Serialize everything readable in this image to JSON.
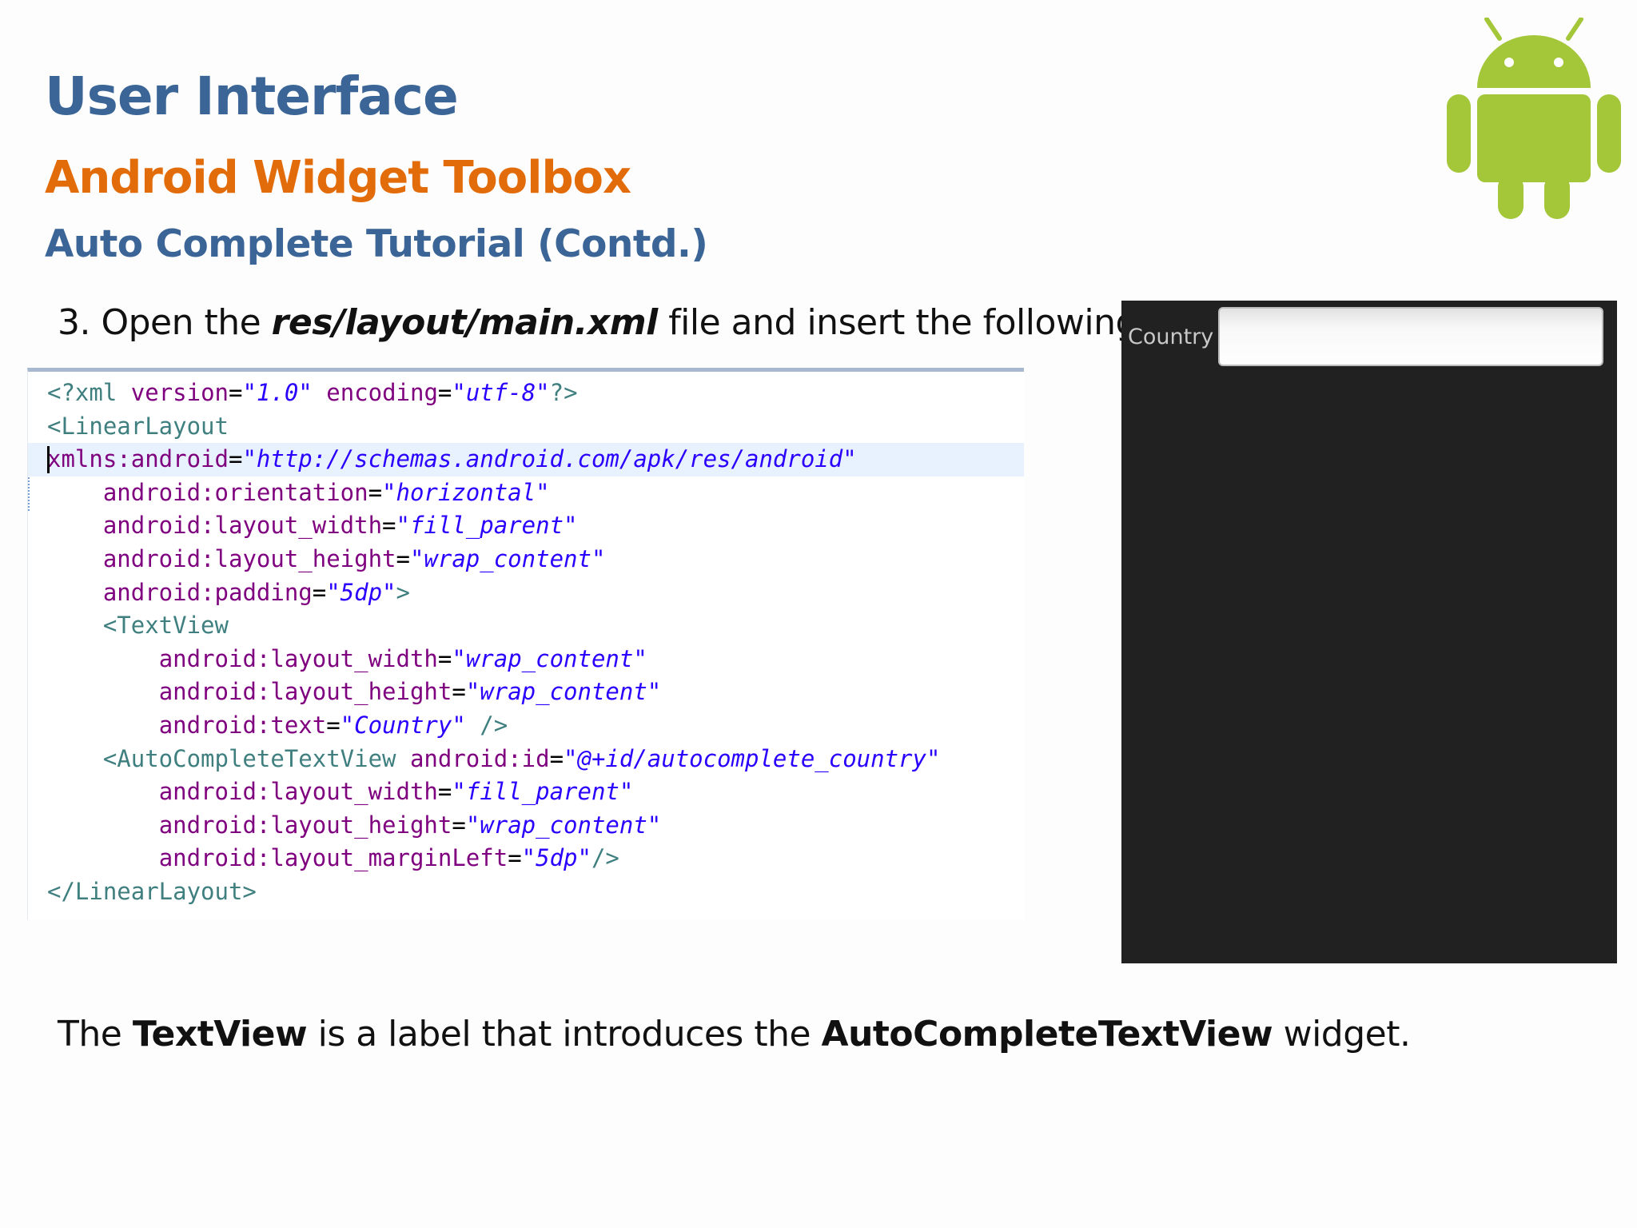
{
  "slide": {
    "title": "User Interface",
    "subtitle": "Android Widget Toolbox",
    "subtitle2": "Auto Complete Tutorial (Contd.)",
    "logo_icon": "android-robot-icon",
    "colors": {
      "title": "#3b6596",
      "subtitle": "#e36c0a",
      "logo": "#a4c639"
    }
  },
  "instruction": {
    "prefix": "3. Open the ",
    "path": "res/layout/main.xml",
    "suffix": " file and insert the following:"
  },
  "code": [
    [
      {
        "t": "tag",
        "v": "<?xml "
      },
      {
        "t": "attr",
        "v": "version"
      },
      {
        "t": "eq",
        "v": "="
      },
      {
        "t": "val",
        "v": "\"1.0\""
      },
      {
        "t": "tag",
        "v": " "
      },
      {
        "t": "attr",
        "v": "encoding"
      },
      {
        "t": "eq",
        "v": "="
      },
      {
        "t": "val",
        "v": "\"utf-8\""
      },
      {
        "t": "tag",
        "v": "?>"
      }
    ],
    [
      {
        "t": "tag",
        "v": "<LinearLayout"
      }
    ],
    [
      {
        "t": "attr",
        "v": "xmlns:android"
      },
      {
        "t": "eq",
        "v": "="
      },
      {
        "t": "val",
        "v": "\"http://schemas.android.com/apk/res/android\""
      }
    ],
    [
      {
        "t": "tag",
        "v": "    "
      },
      {
        "t": "attr",
        "v": "android:orientation"
      },
      {
        "t": "eq",
        "v": "="
      },
      {
        "t": "val",
        "v": "\"horizontal\""
      }
    ],
    [
      {
        "t": "tag",
        "v": "    "
      },
      {
        "t": "attr",
        "v": "android:layout_width"
      },
      {
        "t": "eq",
        "v": "="
      },
      {
        "t": "val",
        "v": "\"fill_parent\""
      }
    ],
    [
      {
        "t": "tag",
        "v": "    "
      },
      {
        "t": "attr",
        "v": "android:layout_height"
      },
      {
        "t": "eq",
        "v": "="
      },
      {
        "t": "val",
        "v": "\"wrap_content\""
      }
    ],
    [
      {
        "t": "tag",
        "v": "    "
      },
      {
        "t": "attr",
        "v": "android:padding"
      },
      {
        "t": "eq",
        "v": "="
      },
      {
        "t": "val",
        "v": "\"5dp\""
      },
      {
        "t": "tag",
        "v": ">"
      }
    ],
    [
      {
        "t": "tag",
        "v": "    <TextView"
      }
    ],
    [
      {
        "t": "tag",
        "v": "        "
      },
      {
        "t": "attr",
        "v": "android:layout_width"
      },
      {
        "t": "eq",
        "v": "="
      },
      {
        "t": "val",
        "v": "\"wrap_content\""
      }
    ],
    [
      {
        "t": "tag",
        "v": "        "
      },
      {
        "t": "attr",
        "v": "android:layout_height"
      },
      {
        "t": "eq",
        "v": "="
      },
      {
        "t": "val",
        "v": "\"wrap_content\""
      }
    ],
    [
      {
        "t": "tag",
        "v": "        "
      },
      {
        "t": "attr",
        "v": "android:text"
      },
      {
        "t": "eq",
        "v": "="
      },
      {
        "t": "val",
        "v": "\"Country\""
      },
      {
        "t": "tag",
        "v": " />"
      }
    ],
    [
      {
        "t": "tag",
        "v": "    <AutoCompleteTextView "
      },
      {
        "t": "attr",
        "v": "android:id"
      },
      {
        "t": "eq",
        "v": "="
      },
      {
        "t": "val",
        "v": "\"@+id/autocomplete_country\""
      }
    ],
    [
      {
        "t": "tag",
        "v": "        "
      },
      {
        "t": "attr",
        "v": "android:layout_width"
      },
      {
        "t": "eq",
        "v": "="
      },
      {
        "t": "val",
        "v": "\"fill_parent\""
      }
    ],
    [
      {
        "t": "tag",
        "v": "        "
      },
      {
        "t": "attr",
        "v": "android:layout_height"
      },
      {
        "t": "eq",
        "v": "="
      },
      {
        "t": "val",
        "v": "\"wrap_content\""
      }
    ],
    [
      {
        "t": "tag",
        "v": "        "
      },
      {
        "t": "attr",
        "v": "android:layout_marginLeft"
      },
      {
        "t": "eq",
        "v": "="
      },
      {
        "t": "val",
        "v": "\"5dp\""
      },
      {
        "t": "tag",
        "v": "/>"
      }
    ],
    [
      {
        "t": "tag",
        "v": "</LinearLayout>"
      }
    ]
  ],
  "code_highlight_line": 2,
  "emulator": {
    "label": "Country",
    "input_value": ""
  },
  "footer": {
    "p1": "The ",
    "b1": "TextView",
    "p2": " is a label that introduces the ",
    "b2": "AutoCompleteTextView",
    "p3": " widget."
  }
}
